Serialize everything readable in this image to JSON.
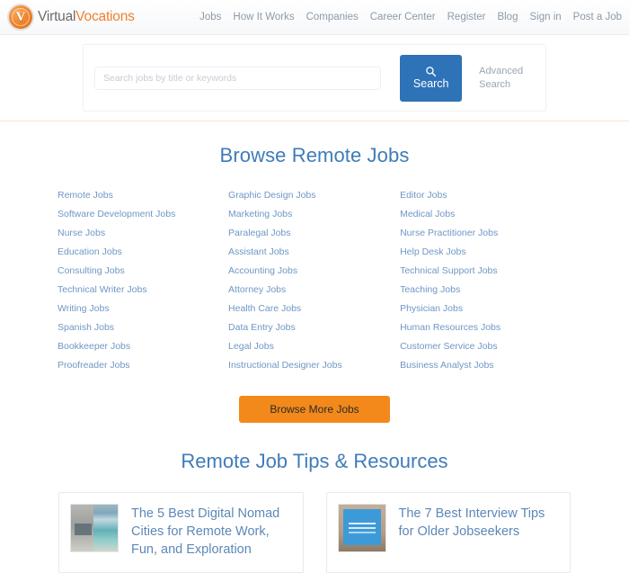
{
  "header": {
    "brand": {
      "badge_letter": "V",
      "word_one": "Virtual",
      "word_two": "Vocations"
    },
    "nav": [
      {
        "label": "Jobs"
      },
      {
        "label": "How It Works"
      },
      {
        "label": "Companies"
      },
      {
        "label": "Career Center"
      },
      {
        "label": "Register"
      },
      {
        "label": "Blog"
      },
      {
        "label": "Sign in"
      },
      {
        "label": "Post a Job"
      }
    ]
  },
  "search": {
    "placeholder": "Search jobs by title or keywords",
    "value": "",
    "button_label": "Search",
    "button_icon": "search-icon",
    "advanced_label": "Advanced Search",
    "button_color": "#2e72b8"
  },
  "browse": {
    "title": "Browse Remote Jobs",
    "columns": [
      [
        {
          "label": "Remote Jobs"
        },
        {
          "label": "Software Development Jobs"
        },
        {
          "label": "Nurse Jobs"
        },
        {
          "label": "Education Jobs"
        },
        {
          "label": "Consulting Jobs"
        },
        {
          "label": "Technical Writer Jobs"
        },
        {
          "label": "Writing Jobs"
        },
        {
          "label": "Spanish Jobs"
        },
        {
          "label": "Bookkeeper Jobs"
        },
        {
          "label": "Proofreader Jobs"
        }
      ],
      [
        {
          "label": "Graphic Design Jobs"
        },
        {
          "label": "Marketing Jobs"
        },
        {
          "label": "Paralegal Jobs"
        },
        {
          "label": "Assistant Jobs"
        },
        {
          "label": "Accounting Jobs"
        },
        {
          "label": "Attorney Jobs"
        },
        {
          "label": "Health Care Jobs"
        },
        {
          "label": "Data Entry Jobs"
        },
        {
          "label": "Legal Jobs"
        },
        {
          "label": "Instructional Designer Jobs"
        }
      ],
      [
        {
          "label": "Editor Jobs"
        },
        {
          "label": "Medical Jobs"
        },
        {
          "label": "Nurse Practitioner Jobs"
        },
        {
          "label": "Help Desk Jobs"
        },
        {
          "label": "Technical Support Jobs"
        },
        {
          "label": "Teaching Jobs"
        },
        {
          "label": "Physician Jobs"
        },
        {
          "label": "Human Resources Jobs"
        },
        {
          "label": "Customer Service Jobs"
        },
        {
          "label": "Business Analyst Jobs"
        }
      ]
    ],
    "more_button_label": "Browse More Jobs",
    "more_button_color": "#f3891a",
    "heading_color": "#3f7cb8"
  },
  "tips": {
    "title": "Remote Job Tips & Resources",
    "cards": [
      {
        "title": "The 5 Best Digital Nomad Cities for Remote Work, Fun, and Exploration",
        "thumbnail": "beach-photo-thumbnail"
      },
      {
        "title": "The 7 Best Interview Tips for Older Jobseekers",
        "thumbnail": "interview-infographic-thumbnail"
      }
    ]
  }
}
